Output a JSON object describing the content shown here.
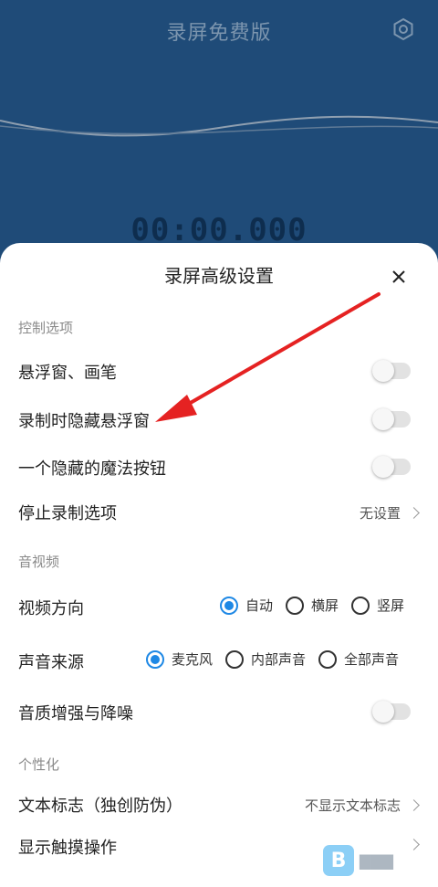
{
  "header": {
    "title": "录屏免费版",
    "timer": "00:00.000",
    "bg_color": "#1f4b78"
  },
  "sheet": {
    "title": "录屏高级设置",
    "sections": {
      "control": "控制选项",
      "av": "音视频",
      "personal": "个性化"
    },
    "rows": {
      "floating_pen": {
        "label": "悬浮窗、画笔",
        "enabled": false
      },
      "hide_floating": {
        "label": "录制时隐藏悬浮窗",
        "enabled": false
      },
      "magic_button": {
        "label": "一个隐藏的魔法按钮",
        "enabled": false
      },
      "stop_options": {
        "label": "停止录制选项",
        "value": "无设置"
      },
      "video_orientation": {
        "label": "视频方向",
        "options": [
          "自动",
          "横屏",
          "竖屏"
        ],
        "selected": "自动"
      },
      "audio_source": {
        "label": "声音来源",
        "options": [
          "麦克风",
          "内部声音",
          "全部声音"
        ],
        "selected": "麦克风"
      },
      "audio_enhance": {
        "label": "音质增强与降噪",
        "enabled": false
      },
      "text_logo": {
        "label": "文本标志（独创防伪）",
        "value": "不显示文本标志"
      },
      "show_touches": {
        "label": "显示触摸操作"
      }
    }
  },
  "accent_color": "#1e88e5",
  "annotation_arrow_color": "#e52222",
  "icons": [
    "gear-icon",
    "close-icon",
    "chevron-right-icon",
    "watermark-logo"
  ]
}
